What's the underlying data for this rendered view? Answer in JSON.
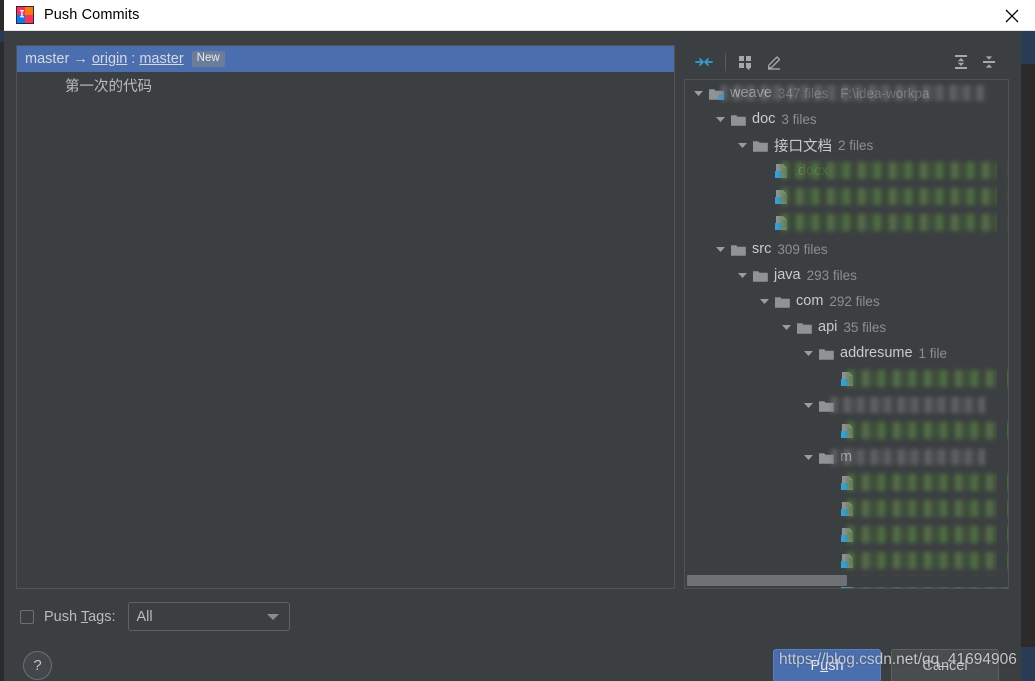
{
  "window": {
    "title": "Push Commits",
    "app_icon": "intellij-idea-icon",
    "close_icon": "close-icon"
  },
  "commits": {
    "branch_row": {
      "source_branch": "master",
      "arrow": "→",
      "remote": "origin",
      "separator": ":",
      "target_branch": "master",
      "badge": "New",
      "selected": true
    },
    "commit_message": "第一次的代码"
  },
  "changes": {
    "toolbar": {
      "show_diff_label": "show-diff-icon",
      "group_by_label": "group-by-icon",
      "edit_source_label": "edit-source-icon",
      "expand_all_label": "expand-all-icon",
      "collapse_all_label": "collapse-all-icon"
    },
    "tree": [
      {
        "depth": 0,
        "name": "weave",
        "count": "347 files",
        "path": "F:\\idea-workpa",
        "kind": "root-folder",
        "expanded": true,
        "redacted": true
      },
      {
        "depth": 1,
        "name": "doc",
        "count": "3 files",
        "kind": "folder",
        "expanded": true,
        "redacted": false
      },
      {
        "depth": 2,
        "name": "接口文档",
        "count": "2 files",
        "kind": "folder",
        "expanded": true,
        "redacted": false
      },
      {
        "depth": 3,
        "name": ".docx",
        "count": "",
        "kind": "file",
        "expanded": false,
        "redacted": true
      },
      {
        "depth": 3,
        "name": "",
        "count": "",
        "kind": "file",
        "expanded": false,
        "redacted": true
      },
      {
        "depth": 3,
        "name": "",
        "count": "",
        "kind": "file",
        "expanded": false,
        "redacted": true
      },
      {
        "depth": 1,
        "name": "src",
        "count": "309 files",
        "kind": "folder",
        "expanded": true,
        "redacted": false
      },
      {
        "depth": 2,
        "name": "java",
        "count": "293 files",
        "kind": "folder",
        "expanded": true,
        "redacted": false
      },
      {
        "depth": 3,
        "name": "com",
        "count": "292 files",
        "kind": "folder",
        "expanded": true,
        "redacted": false
      },
      {
        "depth": 4,
        "name": "api",
        "count": "35 files",
        "kind": "folder",
        "expanded": true,
        "redacted": false
      },
      {
        "depth": 5,
        "name": "addresume",
        "count": "1 file",
        "kind": "folder",
        "expanded": true,
        "redacted": false
      },
      {
        "depth": 6,
        "name": "",
        "count": "",
        "kind": "file",
        "expanded": false,
        "redacted": true
      },
      {
        "depth": 5,
        "name": "",
        "count": "",
        "kind": "folder",
        "expanded": true,
        "redacted": true
      },
      {
        "depth": 6,
        "name": "",
        "count": "",
        "kind": "file",
        "expanded": false,
        "redacted": true
      },
      {
        "depth": 5,
        "name": "m",
        "count": "",
        "kind": "folder",
        "expanded": true,
        "redacted": true
      },
      {
        "depth": 6,
        "name": "",
        "count": "",
        "kind": "file",
        "expanded": false,
        "redacted": true
      },
      {
        "depth": 6,
        "name": "",
        "count": "",
        "kind": "file",
        "expanded": false,
        "redacted": true
      },
      {
        "depth": 6,
        "name": "",
        "count": "",
        "kind": "file",
        "expanded": false,
        "redacted": true
      },
      {
        "depth": 6,
        "name": "",
        "count": "",
        "kind": "file",
        "expanded": false,
        "redacted": true
      },
      {
        "depth": 6,
        "name": "",
        "count": "",
        "kind": "file",
        "expanded": false,
        "redacted": true
      },
      {
        "depth": 5,
        "name": "",
        "count": "",
        "kind": "folder",
        "expanded": true,
        "redacted": true
      }
    ]
  },
  "options": {
    "push_tags_label_pre": "Push ",
    "push_tags_label_mnemonic": "T",
    "push_tags_label_post": "ags:",
    "push_tags_checked": false,
    "tags_select_value": "All"
  },
  "footer": {
    "help_label": "?",
    "push_label_pre": "P",
    "push_label_mnemonic": "u",
    "push_label_post": "sh",
    "cancel_label": "Cancel"
  },
  "watermark": {
    "text": "https://blog.csdn.net/qq_41694906"
  },
  "colors": {
    "selection_blue": "#4b6eaf",
    "panel_bg": "#3c3f41",
    "titlebar_bg": "#ffffff",
    "added_file_green": "#5c8a4e",
    "accent_icon_blue": "#389fd6"
  }
}
